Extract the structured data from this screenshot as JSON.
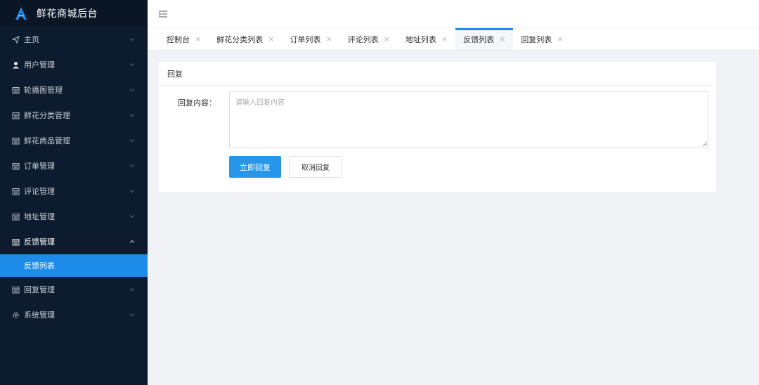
{
  "brand": {
    "title": "鲜花商城后台",
    "logo_icon": "a-logo-icon",
    "logo_color": "#1d8ce8"
  },
  "sidebar": {
    "items": [
      {
        "label": "主页",
        "icon": "send-icon",
        "open": false
      },
      {
        "label": "用户管理",
        "icon": "user-icon",
        "open": false
      },
      {
        "label": "轮播图管理",
        "icon": "calendar-icon",
        "open": false
      },
      {
        "label": "鲜花分类管理",
        "icon": "calendar-icon",
        "open": false
      },
      {
        "label": "鲜花商品管理",
        "icon": "calendar-icon",
        "open": false
      },
      {
        "label": "订单管理",
        "icon": "calendar-icon",
        "open": false
      },
      {
        "label": "评论管理",
        "icon": "calendar-icon",
        "open": false
      },
      {
        "label": "地址管理",
        "icon": "calendar-icon",
        "open": false
      },
      {
        "label": "反馈管理",
        "icon": "calendar-icon",
        "open": true,
        "children": [
          {
            "label": "反馈列表",
            "active": true
          }
        ]
      },
      {
        "label": "回复管理",
        "icon": "calendar-icon",
        "open": false
      },
      {
        "label": "系统管理",
        "icon": "gear-icon",
        "open": false
      }
    ],
    "active_color": "#1d8ce8",
    "bg_color": "#0c1b2d"
  },
  "header": {
    "fold_icon": "menu-fold-icon"
  },
  "tabs": [
    {
      "label": "控制台",
      "active": false
    },
    {
      "label": "鲜花分类列表",
      "active": false
    },
    {
      "label": "订单列表",
      "active": false
    },
    {
      "label": "评论列表",
      "active": false
    },
    {
      "label": "地址列表",
      "active": false
    },
    {
      "label": "反馈列表",
      "active": true
    },
    {
      "label": "回复列表",
      "active": false
    }
  ],
  "card": {
    "title": "回复",
    "reply_label": "回复内容：",
    "reply_value": "",
    "reply_placeholder": "请输入回复内容",
    "submit_label": "立即回复",
    "cancel_label": "取消回复"
  }
}
